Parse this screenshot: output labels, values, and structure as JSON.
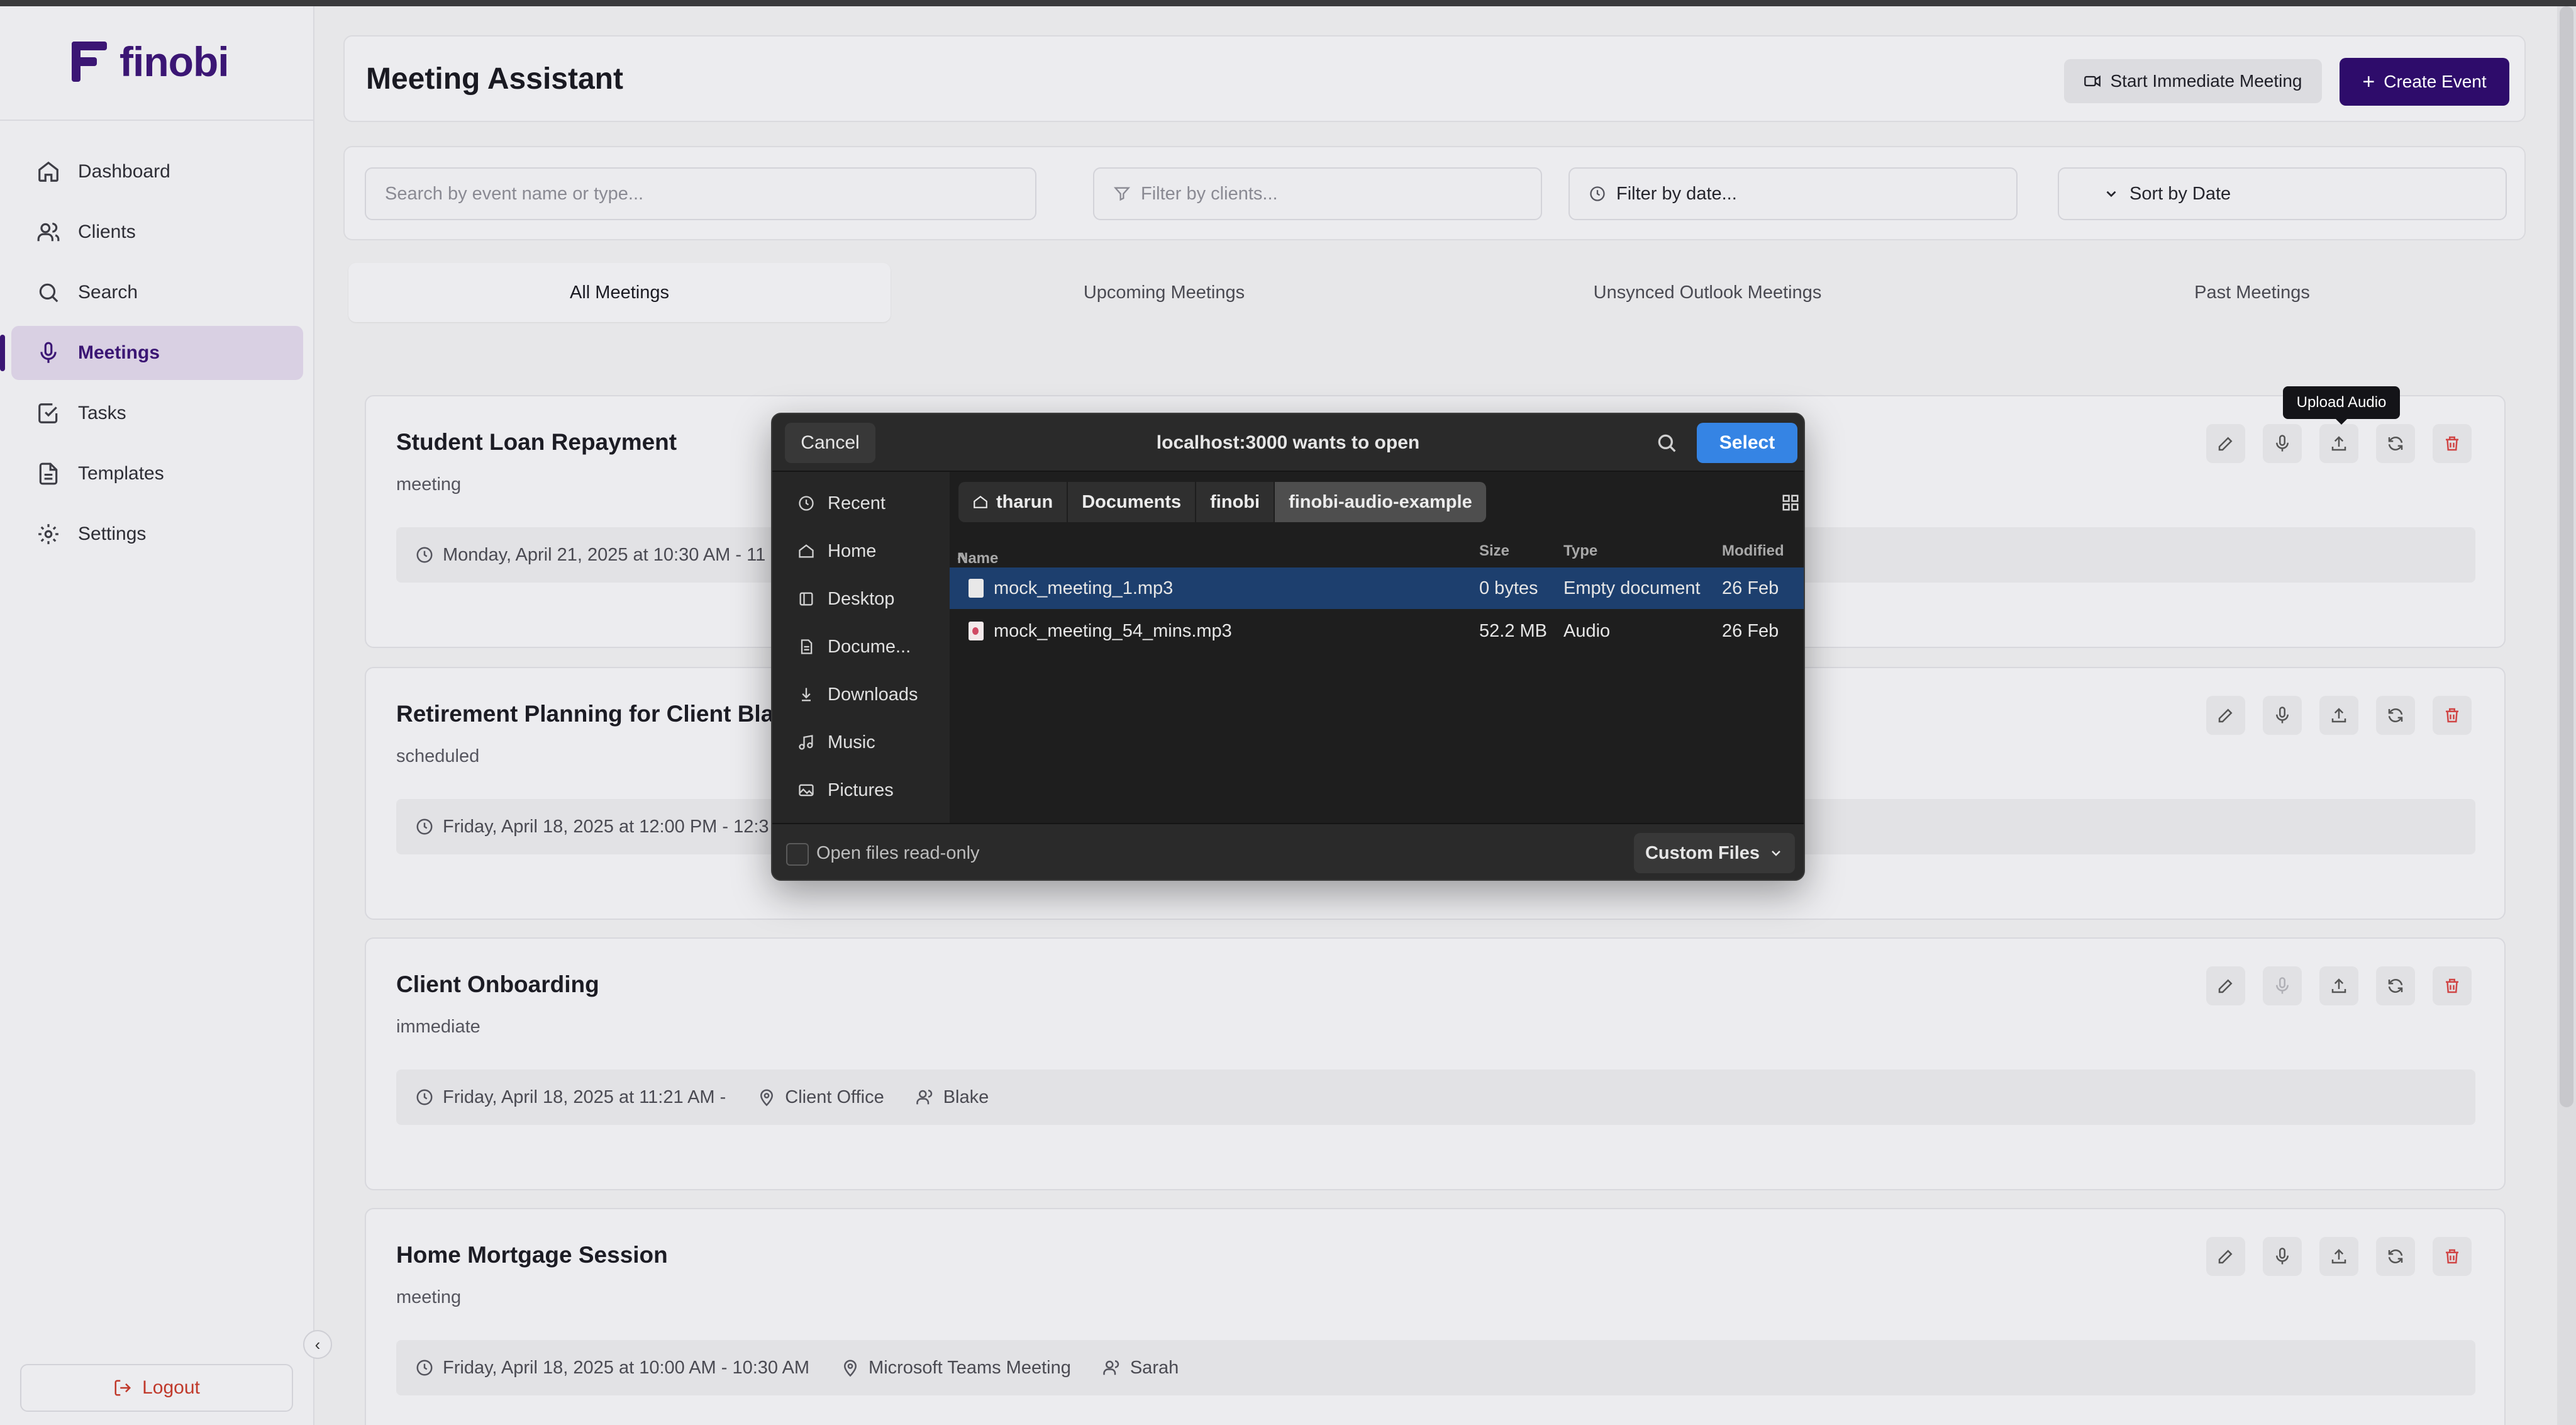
{
  "brand": {
    "name": "finobi",
    "color": "#3b1674"
  },
  "nav": [
    {
      "label": "Dashboard",
      "icon": "home-icon"
    },
    {
      "label": "Clients",
      "icon": "users-icon"
    },
    {
      "label": "Search",
      "icon": "search-icon"
    },
    {
      "label": "Meetings",
      "icon": "mic-icon",
      "active": true
    },
    {
      "label": "Tasks",
      "icon": "check-square-icon"
    },
    {
      "label": "Templates",
      "icon": "file-icon"
    },
    {
      "label": "Settings",
      "icon": "gear-icon"
    }
  ],
  "logout_label": "Logout",
  "header": {
    "title": "Meeting Assistant",
    "start_label": "Start Immediate Meeting",
    "create_label": "Create Event"
  },
  "filters": {
    "search_placeholder": "Search by event name or type...",
    "clients_placeholder": "Filter by clients...",
    "date_label": "Filter by date...",
    "sort_label": "Sort by Date"
  },
  "tabs": [
    "All Meetings",
    "Upcoming Meetings",
    "Unsynced Outlook Meetings",
    "Past Meetings"
  ],
  "tooltip": "Upload Audio",
  "meetings": [
    {
      "title": "Student Loan Repayment",
      "type": "meeting",
      "date": "Monday, April 21, 2025 at 10:30 AM - 11",
      "location": "",
      "person": ""
    },
    {
      "title": "Retirement Planning for Client Blak",
      "type": "scheduled",
      "date": "Friday, April 18, 2025 at 12:00 PM - 12:3",
      "location": "",
      "person": ""
    },
    {
      "title": "Client Onboarding",
      "type": "immediate",
      "date": "Friday, April 18, 2025 at 11:21 AM -",
      "location": "Client Office",
      "person": "Blake"
    },
    {
      "title": "Home Mortgage Session",
      "type": "meeting",
      "date": "Friday, April 18, 2025 at 10:00 AM - 10:30 AM",
      "location": "Microsoft Teams Meeting",
      "person": "Sarah"
    }
  ],
  "dialog": {
    "title": "localhost:3000 wants to open",
    "cancel": "Cancel",
    "select": "Select",
    "places": [
      "Recent",
      "Home",
      "Desktop",
      "Docume...",
      "Downloads",
      "Music",
      "Pictures"
    ],
    "breadcrumbs": [
      "tharun",
      "Documents",
      "finobi",
      "finobi-audio-example"
    ],
    "columns": {
      "name": "Name",
      "size": "Size",
      "type": "Type",
      "modified": "Modified"
    },
    "files": [
      {
        "name": "mock_meeting_1.mp3",
        "size": "0 bytes",
        "type": "Empty document",
        "modified": "26 Feb",
        "selected": true
      },
      {
        "name": "mock_meeting_54_mins.mp3",
        "size": "52.2 MB",
        "type": "Audio",
        "modified": "26 Feb",
        "selected": false
      }
    ],
    "readonly_label": "Open files read-only",
    "filter_label": "Custom Files"
  }
}
